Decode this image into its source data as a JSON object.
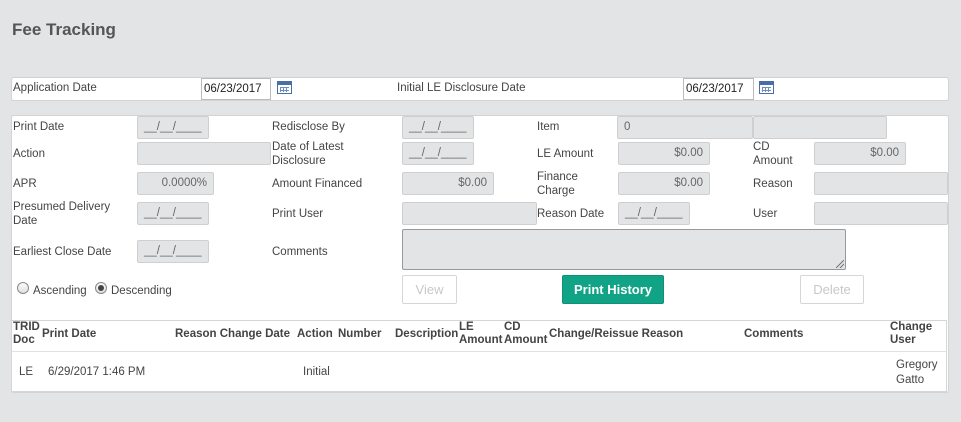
{
  "page": {
    "title": "Fee Tracking"
  },
  "top": {
    "application_date_label": "Application Date",
    "application_date_value": "06/23/2017",
    "initial_le_label": "Initial LE Disclosure Date",
    "initial_le_value": "06/23/2017"
  },
  "form": {
    "print_date_label": "Print Date",
    "print_date_value": "__/__/____",
    "action_label": "Action",
    "action_value": "",
    "apr_label": "APR",
    "apr_value": "0.0000%",
    "presumed_delivery_label": "Presumed Delivery Date",
    "presumed_delivery_value": "__/__/____",
    "earliest_close_label": "Earliest Close Date",
    "earliest_close_value": "__/__/____",
    "redisclose_by_label": "Redisclose By",
    "redisclose_by_value": "__/__/____",
    "date_latest_label": "Date of Latest Disclosure",
    "date_latest_value": "__/__/____",
    "amount_financed_label": "Amount Financed",
    "amount_financed_value": "$0.00",
    "print_user_label": "Print User",
    "print_user_value": "",
    "comments_label": "Comments",
    "comments_value": "",
    "item_label": "Item",
    "item_value": "0",
    "item_value2": "",
    "le_amount_label": "LE Amount",
    "le_amount_value": "$0.00",
    "finance_charge_label": "Finance Charge",
    "finance_charge_value": "$0.00",
    "reason_date_label": "Reason Date",
    "reason_date_value": "__/__/____",
    "cd_amount_label": "CD Amount",
    "cd_amount_value": "$0.00",
    "reason_label": "Reason",
    "reason_value": "",
    "user_label": "User",
    "user_value": ""
  },
  "sort": {
    "ascending_label": "Ascending",
    "descending_label": "Descending",
    "selected": "Descending"
  },
  "buttons": {
    "view_label": "View",
    "print_history_label": "Print History",
    "delete_label": "Delete"
  },
  "table": {
    "headers": {
      "trid_doc": "TRID Doc",
      "print_date": "Print Date",
      "reason_change_date": "Reason Change Date",
      "action": "Action",
      "number": "Number",
      "description": "Description",
      "le_amount": "LE Amount",
      "cd_amount": "CD Amount",
      "change_reissue_reason": "Change/Reissue Reason",
      "comments": "Comments",
      "change_user": "Change User"
    },
    "rows": [
      {
        "trid_doc": "LE",
        "print_date": "6/29/2017 1:46 PM",
        "reason_change_date": "",
        "action": "Initial",
        "number": "",
        "description": "",
        "le_amount": "",
        "cd_amount": "",
        "change_reissue_reason": "",
        "comments": "",
        "change_user": "Gregory Gatto"
      }
    ]
  },
  "colors": {
    "primary_button": "#11a386",
    "background": "#e3e4e5",
    "calendar_icon": "#4a6fa5"
  },
  "icons": {
    "calendar": "calendar-icon"
  }
}
